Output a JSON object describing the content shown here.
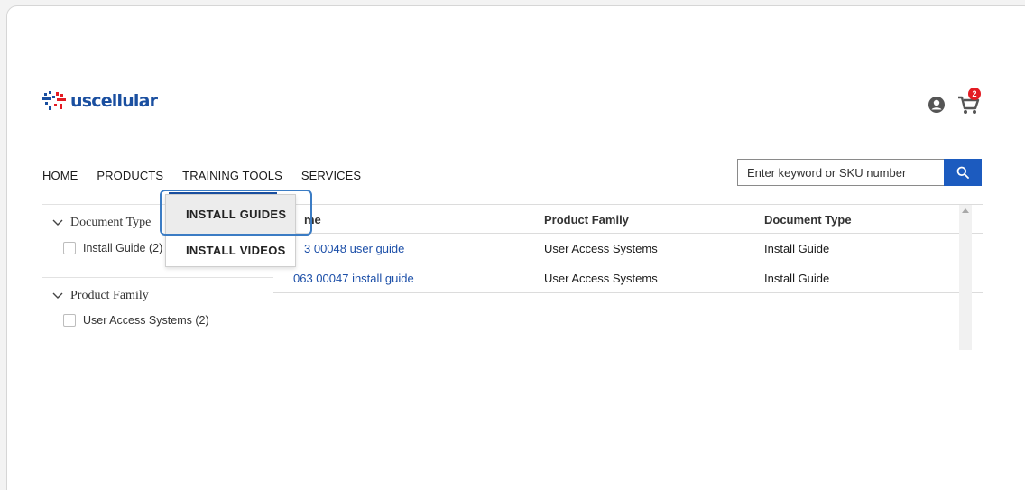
{
  "header": {
    "logo_text": "uscellular",
    "cart_count": "2",
    "icons": [
      "account-icon",
      "cart-icon"
    ]
  },
  "nav": {
    "items": [
      "HOME",
      "PRODUCTS",
      "TRAINING TOOLS",
      "SERVICES"
    ],
    "active": "TRAINING TOOLS"
  },
  "search": {
    "placeholder": "Enter keyword or SKU number",
    "icon": "search-icon"
  },
  "dropdown": {
    "items": [
      "INSTALL GUIDES",
      "INSTALL VIDEOS"
    ]
  },
  "filters": {
    "facets": [
      {
        "title": "Document Type",
        "options": [
          "Install Guide (2)"
        ]
      },
      {
        "title": "Product Family",
        "options": [
          "User Access Systems (2)"
        ]
      }
    ]
  },
  "table": {
    "headers": [
      "Name",
      "Product Family",
      "Document Type"
    ],
    "header_visible_fragment": "me",
    "rows": [
      [
        "063 00048 user guide",
        "User Access Systems",
        "Install Guide"
      ],
      [
        "063 00047 install guide",
        "User Access Systems",
        "Install Guide"
      ]
    ],
    "row1_visible_name": "3 00048 user guide"
  },
  "colors": {
    "brand_blue": "#1a4fa0",
    "link_blue": "#1c4fa8",
    "search_button": "#1c5bbf",
    "badge_red": "#e31b23",
    "highlight": "#3b7cc4"
  }
}
